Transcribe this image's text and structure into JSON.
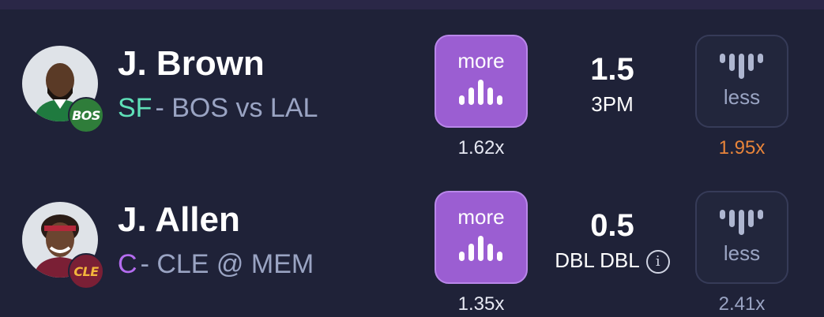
{
  "picks": [
    {
      "player_name": "J. Brown",
      "position": "SF",
      "position_color": "#5fe0b8",
      "matchup": "BOS vs LAL",
      "team_badge": "BOS",
      "badge_color": "#2f7d3a",
      "more_label": "more",
      "less_label": "less",
      "line": "1.5",
      "stat": "3PM",
      "more_multiplier": "1.62x",
      "less_multiplier": "1.95x",
      "less_multiplier_color": "#e8843a",
      "has_info_icon": false
    },
    {
      "player_name": "J. Allen",
      "position": "C",
      "position_color": "#b46cf0",
      "matchup": "CLE @ MEM",
      "team_badge": "CLE",
      "badge_color": "#7a1f35",
      "more_label": "more",
      "less_label": "less",
      "line": "0.5",
      "stat": "DBL DBL",
      "more_multiplier": "1.35x",
      "less_multiplier": "2.41x",
      "less_multiplier_color": "#9aa4c3",
      "has_info_icon": true
    }
  ],
  "icons": {
    "more": "bars-up-icon",
    "less": "bars-down-icon",
    "info": "info-icon"
  }
}
